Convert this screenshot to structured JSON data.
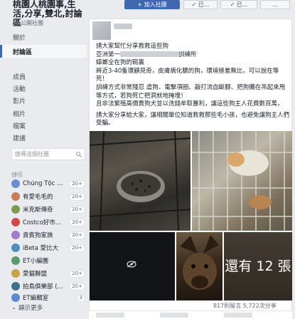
{
  "header": {
    "join_label": "+ 加入社團",
    "btn1": "✓ 已...",
    "btn2": "✓ 已...",
    "btn3": "..."
  },
  "group": {
    "name": "桃園人桃園事,生活,分享,雙北,討論區",
    "type": "公開社團"
  },
  "nav": {
    "items": [
      {
        "label": "關於"
      },
      {
        "label": "討論區"
      },
      {
        "label": "成員"
      },
      {
        "label": "活動"
      },
      {
        "label": "影片"
      },
      {
        "label": "相片"
      },
      {
        "label": "檔案"
      },
      {
        "label": "建議"
      }
    ]
  },
  "search": {
    "placeholder": "搜尋這個社團"
  },
  "shortcuts": {
    "label": "捷徑",
    "items": [
      {
        "label": "Chủng Tộc Đại N...",
        "badge": "20+",
        "color": "#6b8cd6"
      },
      {
        "label": "有愛毛毛的",
        "badge": "20+",
        "color": "#c77d5a"
      },
      {
        "label": "米克斯傳奇",
        "badge": "20+",
        "color": "#7b9a57"
      },
      {
        "label": "Costco好市多 商...",
        "badge": "20+",
        "color": "#d04a4a"
      },
      {
        "label": "貴賓狗家族",
        "badge": "20+",
        "color": "#a37bc9"
      },
      {
        "label": "iBeta 愛比大",
        "badge": "20+",
        "color": "#4f8fbf"
      },
      {
        "label": "ET小編團",
        "badge": "",
        "color": "#5c9a6b"
      },
      {
        "label": "愛貓聯盟",
        "badge": "20+",
        "color": "#c9a24a"
      },
      {
        "label": "拍鳥俱樂部 (Bird...",
        "badge": "20+",
        "color": "#3e6f8e"
      },
      {
        "label": "ET編輯室",
        "badge": "3",
        "color": "#5b8ad1"
      }
    ],
    "more_label": "顯示更多"
  },
  "post": {
    "lines": [
      "請大家幫忙分享救救這些狗",
      "亞洲第一",
      "蟑螂全在狗的碗裏",
      "將近3-40隻環顧見奇，皮膚病化膿的狗，環境極差無比，可以說在等死！",
      "訓練方式非常殘忍 虐狗、電擊項圈、敲打流血斷腳、把狗攤在吊起來甩等方式，若狗死亡把洞就地掩埋！",
      "且非法繁殖高價賣狗犬並以洗錢牟取暴利，讓這些狗主人花費數百萬，",
      "請大家分享給大家，讓相關單位知道救救那些毛小孩，也避免讓狗主人們受騙。"
    ],
    "line2_suffix": "訓練所",
    "more_photos": "還有 12 張"
  },
  "stats": {
    "text": "817則留言 5,722次分享"
  }
}
